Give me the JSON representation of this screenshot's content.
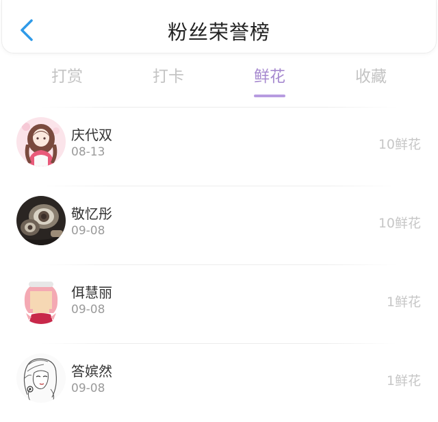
{
  "header": {
    "title": "粉丝荣誉榜",
    "back_icon": "chevron-left-icon"
  },
  "tabs": [
    {
      "label": "打赏",
      "active": false
    },
    {
      "label": "打卡",
      "active": false
    },
    {
      "label": "鲜花",
      "active": true
    },
    {
      "label": "收藏",
      "active": false
    }
  ],
  "fans": [
    {
      "name": "庆代双",
      "date": "08-13",
      "amount": "10鲜花",
      "avatar": "anime-girl-avatar"
    },
    {
      "name": "敬忆彤",
      "date": "09-08",
      "amount": "10鲜花",
      "avatar": "tray-photo-avatar"
    },
    {
      "name": "佴慧丽",
      "date": "09-08",
      "amount": "1鲜花",
      "avatar": "cartoon-girl-avatar"
    },
    {
      "name": "答嫔然",
      "date": "09-08",
      "amount": "1鲜花",
      "avatar": "sketch-woman-avatar"
    }
  ],
  "colors": {
    "accent": "#a689cf",
    "tab_inactive": "#c3c3c3",
    "back_icon": "#2f9ae8"
  }
}
